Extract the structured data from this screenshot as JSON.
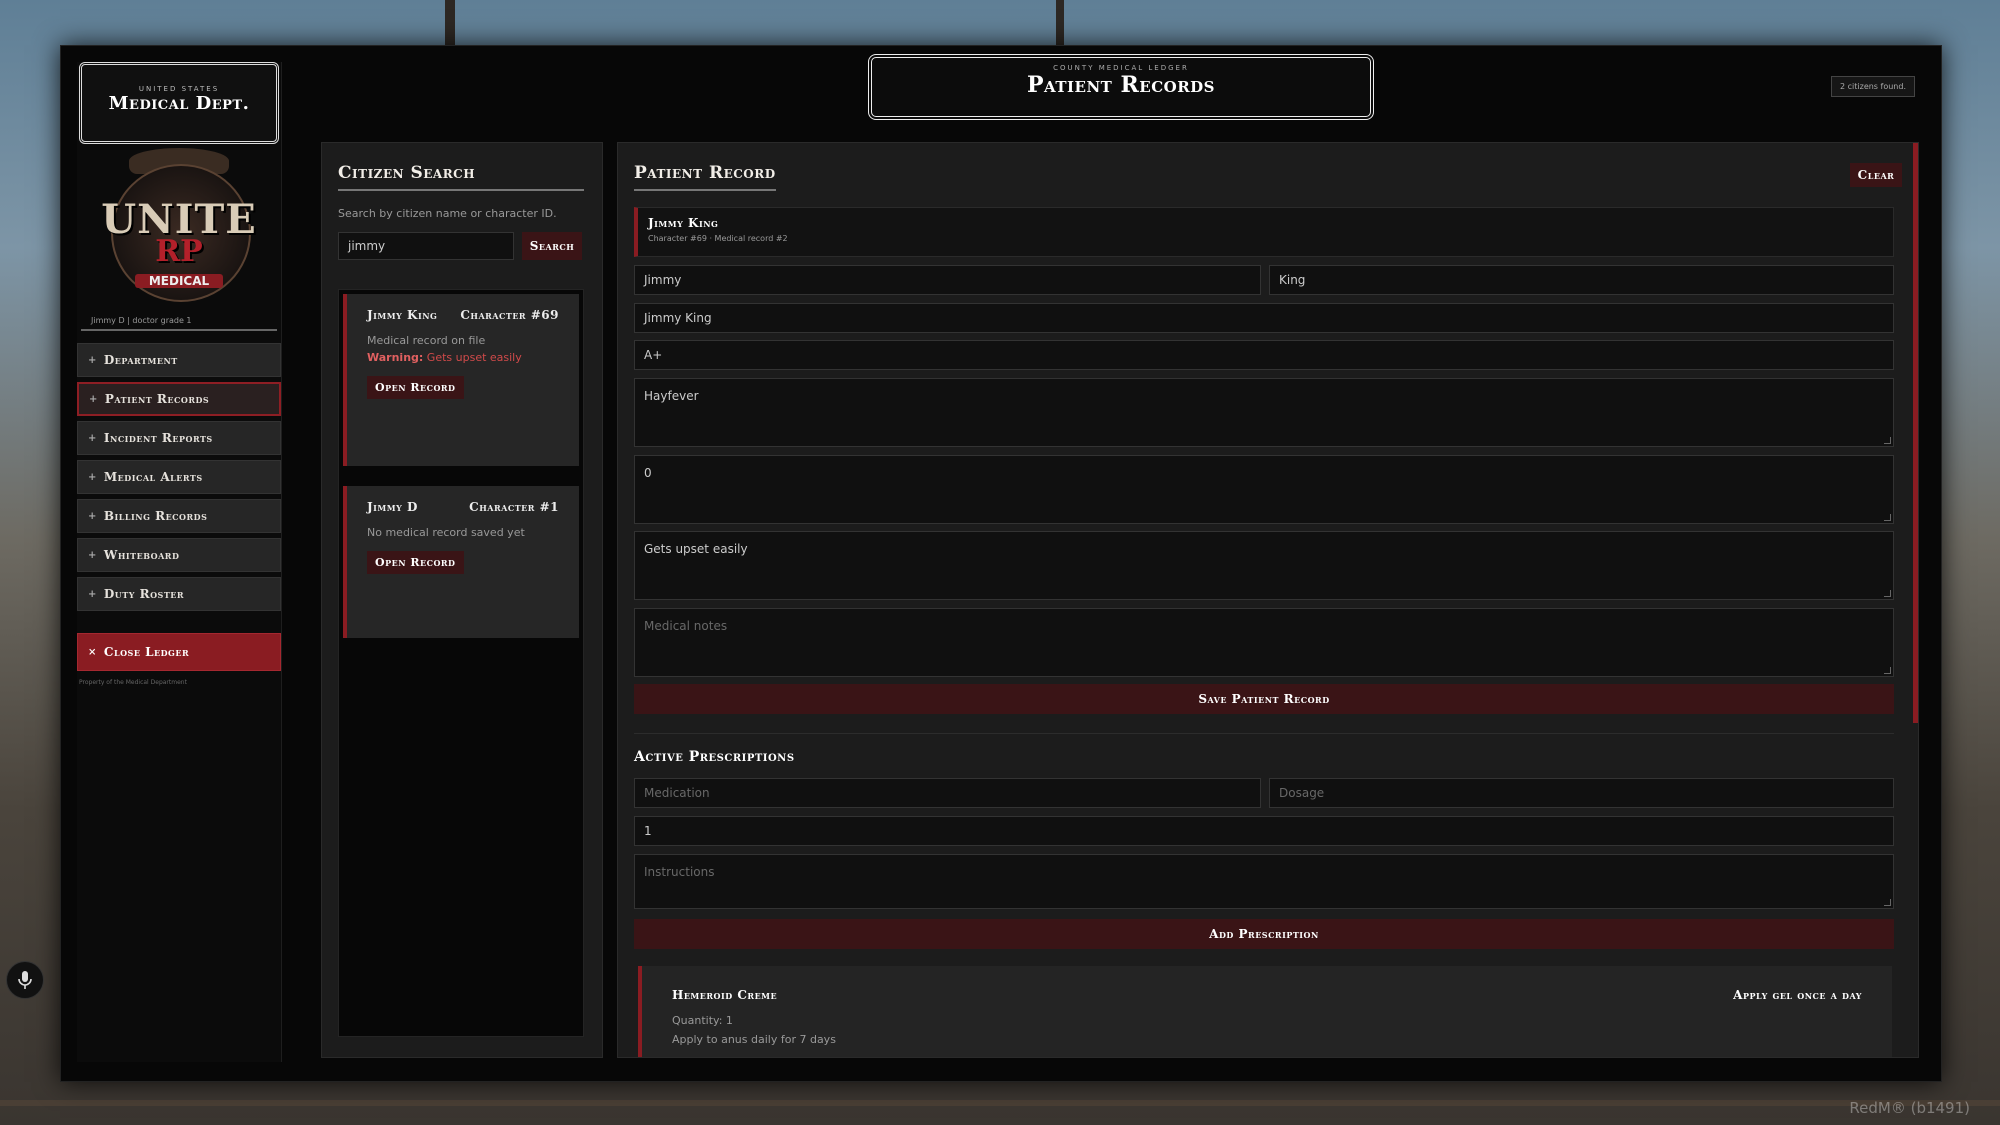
{
  "sidebar": {
    "brand_sub": "UNITED STATES",
    "brand_main": "Medical Dept.",
    "logo_line1": "UNITE",
    "logo_line2": "RP",
    "logo_line3": "MEDICAL",
    "user_line": "Jimmy D | doctor grade 1",
    "items": [
      {
        "label": "Department"
      },
      {
        "label": "Patient Records",
        "active": true
      },
      {
        "label": "Incident Reports"
      },
      {
        "label": "Medical Alerts"
      },
      {
        "label": "Billing Records"
      },
      {
        "label": "Whiteboard"
      },
      {
        "label": "Duty Roster"
      }
    ],
    "close_label": "Close Ledger",
    "footer": "Property of the Medical Department"
  },
  "header": {
    "sub": "COUNTY MEDICAL LEDGER",
    "title": "Patient Records",
    "count_badge": "2 citizens found."
  },
  "search": {
    "title": "Citizen Search",
    "help": "Search by citizen name or character ID.",
    "query": "jimmy",
    "button": "Search",
    "results": [
      {
        "name": "Jimmy King",
        "character": "Character #69",
        "status": "Medical record on file",
        "warning_label": "Warning:",
        "warning_text": "Gets upset easily",
        "button": "Open Record"
      },
      {
        "name": "Jimmy D",
        "character": "Character #1",
        "status": "No medical record saved yet",
        "button": "Open Record"
      }
    ]
  },
  "record": {
    "title": "Patient Record",
    "clear": "Clear",
    "banner_name": "Jimmy King",
    "banner_meta": "Character #69 · Medical record #2",
    "first_name": "Jimmy",
    "last_name": "King",
    "full_name": "Jimmy King",
    "blood_type": "A+",
    "allergies": "Hayfever",
    "conditions": "0",
    "warnings": "Gets upset easily",
    "notes_placeholder": "Medical notes",
    "save_button": "Save Patient Record"
  },
  "prescriptions": {
    "title": "Active Prescriptions",
    "medication_placeholder": "Medication",
    "dosage_placeholder": "Dosage",
    "quantity_value": "1",
    "instructions_placeholder": "Instructions",
    "add_button": "Add Prescription",
    "items": [
      {
        "name": "Hemeroid Creme",
        "dosage": "Apply gel once a day",
        "quantity_label": "Quantity: 1",
        "instructions": "Apply to anus daily for 7 days"
      }
    ]
  },
  "overlay": {
    "watermark": "RedM® (b1491)"
  },
  "colors": {
    "accent": "#8a1c22",
    "button_bg": "#3a1416",
    "panel_bg": "#1c1c1c",
    "window_bg": "#070707"
  }
}
